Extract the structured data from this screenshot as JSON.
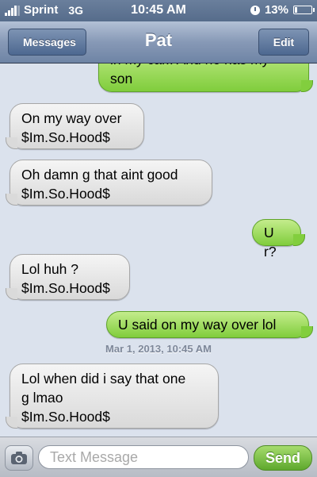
{
  "status_bar": {
    "carrier": "Sprint",
    "network": "3G",
    "time": "10:45 AM",
    "battery": "13%"
  },
  "nav": {
    "back_label": "Messages",
    "title": "Pat",
    "edit_label": "Edit"
  },
  "messages": [
    {
      "direction": "outgoing",
      "text": "in my car.. And he has my\nson"
    },
    {
      "direction": "incoming",
      "text": "On my way over\n$Im.So.Hood$"
    },
    {
      "direction": "incoming",
      "text": "Oh damn g that aint good\n$Im.So.Hood$"
    },
    {
      "direction": "outgoing",
      "text": "U r?"
    },
    {
      "direction": "incoming",
      "text": "Lol huh ?\n$Im.So.Hood$"
    },
    {
      "direction": "outgoing",
      "text": "U said on my way over lol"
    },
    {
      "direction": "incoming",
      "text": "Lol when did i say that one\ng lmao\n$Im.So.Hood$"
    }
  ],
  "timestamp": "Mar 1, 2013, 10:45 AM",
  "input": {
    "placeholder": "Text Message",
    "send_label": "Send"
  },
  "colors": {
    "outgoing_bubble": "#80cd3c",
    "incoming_bubble": "#e5e5e5",
    "background": "#dbe2ed",
    "nav": "#6e84a5"
  },
  "icons": [
    "signal-bars-icon",
    "clock-icon",
    "battery-icon",
    "camera-icon"
  ]
}
